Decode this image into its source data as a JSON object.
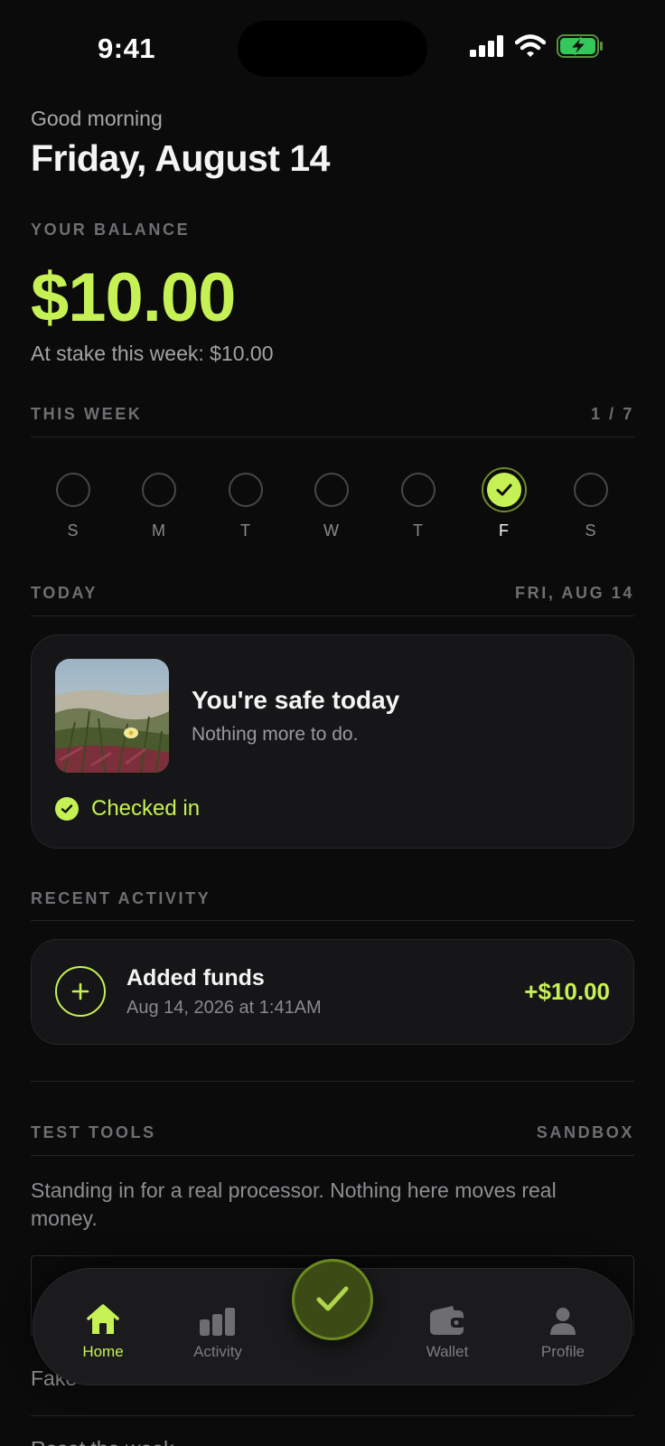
{
  "status": {
    "time": "9:41"
  },
  "header": {
    "greeting": "Good morning",
    "date": "Friday, August 14"
  },
  "balance": {
    "label": "YOUR BALANCE",
    "amount": "$10.00",
    "stake": "At stake this week: $10.00"
  },
  "week": {
    "label": "THIS WEEK",
    "progress": "1 / 7",
    "days": [
      {
        "letter": "S",
        "checked": false
      },
      {
        "letter": "M",
        "checked": false
      },
      {
        "letter": "T",
        "checked": false
      },
      {
        "letter": "W",
        "checked": false
      },
      {
        "letter": "T",
        "checked": false
      },
      {
        "letter": "F",
        "checked": true
      },
      {
        "letter": "S",
        "checked": false
      }
    ]
  },
  "today": {
    "label": "TODAY",
    "date": "FRI, AUG 14",
    "title": "You're safe today",
    "subtitle": "Nothing more to do.",
    "status": "Checked in"
  },
  "activity": {
    "label": "RECENT ACTIVITY",
    "items": [
      {
        "title": "Added funds",
        "date": "Aug 14, 2026 at 1:41AM",
        "amount": "+$10.00"
      }
    ]
  },
  "tools": {
    "label": "TEST TOOLS",
    "badge": "SANDBOX",
    "note": "Standing in for a real processor. Nothing here moves real money.",
    "row1": "Fake",
    "row2": "Reset the week"
  },
  "tabs": [
    {
      "label": "Home",
      "icon": "home-icon",
      "active": true
    },
    {
      "label": "Activity",
      "icon": "bar-chart-icon",
      "active": false
    },
    {
      "label": "Wallet",
      "icon": "wallet-icon",
      "active": false
    },
    {
      "label": "Profile",
      "icon": "person-icon",
      "active": false
    }
  ],
  "colors": {
    "accent": "#c6f154",
    "background": "#0b0b0c",
    "card": "#161618"
  }
}
